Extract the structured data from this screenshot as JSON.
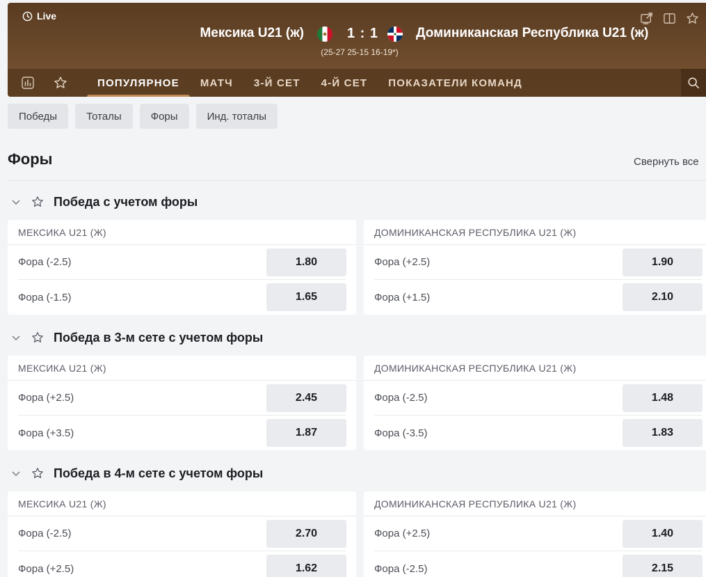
{
  "header": {
    "live_label": "Live",
    "home_team": "Мексика U21 (ж)",
    "away_team": "Доминиканская Республика U21 (ж)",
    "score": "1 : 1",
    "set_scores": "(25-27 25-15 16-19*)"
  },
  "nav": {
    "tabs": [
      {
        "label": "ПОПУЛЯРНОЕ",
        "active": true
      },
      {
        "label": "МАТЧ"
      },
      {
        "label": "3-Й СЕТ"
      },
      {
        "label": "4-Й СЕТ"
      },
      {
        "label": "ПОКАЗАТЕЛИ КОМАНД"
      }
    ]
  },
  "filters": [
    "Победы",
    "Тоталы",
    "Форы",
    "Инд. тоталы"
  ],
  "section": {
    "title": "Форы",
    "collapse_all": "Свернуть все"
  },
  "markets": [
    {
      "title": "Победа с учетом форы",
      "home": {
        "name": "МЕКСИКА U21 (Ж)",
        "rows": [
          {
            "label": "Фора (-2.5)",
            "odd": "1.80"
          },
          {
            "label": "Фора (-1.5)",
            "odd": "1.65"
          }
        ]
      },
      "away": {
        "name": "ДОМИНИКАНСКАЯ РЕСПУБЛИКА U21 (Ж)",
        "rows": [
          {
            "label": "Фора (+2.5)",
            "odd": "1.90"
          },
          {
            "label": "Фора (+1.5)",
            "odd": "2.10"
          }
        ]
      }
    },
    {
      "title": "Победа в 3-м сете с учетом форы",
      "home": {
        "name": "МЕКСИКА U21 (Ж)",
        "rows": [
          {
            "label": "Фора (+2.5)",
            "odd": "2.45"
          },
          {
            "label": "Фора (+3.5)",
            "odd": "1.87"
          }
        ]
      },
      "away": {
        "name": "ДОМИНИКАНСКАЯ РЕСПУБЛИКА U21 (Ж)",
        "rows": [
          {
            "label": "Фора (-2.5)",
            "odd": "1.48"
          },
          {
            "label": "Фора (-3.5)",
            "odd": "1.83"
          }
        ]
      }
    },
    {
      "title": "Победа в 4-м сете с учетом форы",
      "home": {
        "name": "МЕКСИКА U21 (Ж)",
        "rows": [
          {
            "label": "Фора (-2.5)",
            "odd": "2.70"
          },
          {
            "label": "Фора (+2.5)",
            "odd": "1.62"
          }
        ]
      },
      "away": {
        "name": "ДОМИНИКАНСКАЯ РЕСПУБЛИКА U21 (Ж)",
        "rows": [
          {
            "label": "Фора (+2.5)",
            "odd": "1.40"
          },
          {
            "label": "Фора (-2.5)",
            "odd": "2.15"
          }
        ]
      }
    }
  ],
  "icons": {
    "live": "clock-icon",
    "popout": "popout-icon",
    "split": "split-view-icon",
    "favorite": "star-icon",
    "stats": "stats-icon",
    "search": "search-icon",
    "chevron": "chevron-down-icon"
  },
  "colors": {
    "header_brown": "#6d4b2c",
    "active_tab_underline": "#c08a55",
    "page_bg": "#f3f4f6",
    "odd_bg": "#e9ebee"
  }
}
